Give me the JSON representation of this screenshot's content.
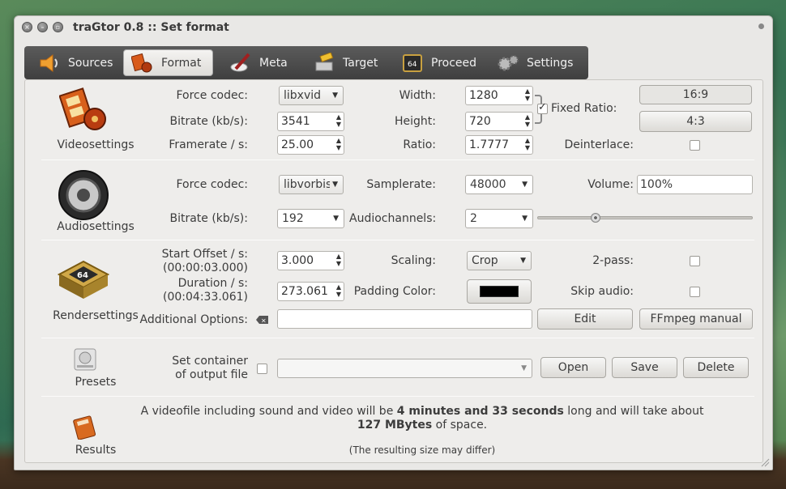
{
  "window": {
    "title": "traGtor 0.8 :: Set format"
  },
  "tabs": [
    {
      "label": "Sources",
      "icon": "speaker-icon"
    },
    {
      "label": "Format",
      "icon": "film-reel-icon",
      "active": true
    },
    {
      "label": "Meta",
      "icon": "pen-icon"
    },
    {
      "label": "Target",
      "icon": "hammer-icon"
    },
    {
      "label": "Proceed",
      "icon": "chip-64-icon"
    },
    {
      "label": "Settings",
      "icon": "gears-icon"
    }
  ],
  "video": {
    "section": "Videosettings",
    "force_codec_label": "Force codec:",
    "force_codec_value": "libxvid",
    "bitrate_label": "Bitrate (kb/s):",
    "bitrate_value": "3541",
    "framerate_label": "Framerate / s:",
    "framerate_value": "25.00",
    "width_label": "Width:",
    "width_value": "1280",
    "height_label": "Height:",
    "height_value": "720",
    "ratio_label": "Ratio:",
    "ratio_value": "1.7777",
    "fixed_ratio_label": "Fixed Ratio:",
    "fixed_ratio_checked": true,
    "btn_169": "16:9",
    "btn_43": "4:3",
    "deinterlace_label": "Deinterlace:"
  },
  "audio": {
    "section": "Audiosettings",
    "force_codec_label": "Force codec:",
    "force_codec_value": "libvorbis",
    "bitrate_label": "Bitrate (kb/s):",
    "bitrate_value": "192",
    "samplerate_label": "Samplerate:",
    "samplerate_value": "48000",
    "channels_label": "Audiochannels:",
    "channels_value": "2",
    "volume_label": "Volume:",
    "volume_value": "100%",
    "volume_level": 0.27
  },
  "render": {
    "section": "Rendersettings",
    "start_offset_label": "Start Offset / s:",
    "start_offset_sub": "(00:00:03.000)",
    "start_offset_value": "3.000",
    "duration_label": "Duration / s:",
    "duration_sub": "(00:04:33.061)",
    "duration_value": "273.061",
    "scaling_label": "Scaling:",
    "scaling_value": "Crop",
    "padding_label": "Padding Color:",
    "padding_color": "#000000",
    "twopass_label": "2-pass:",
    "skipaudio_label": "Skip audio:",
    "additional_label": "Additional Options:",
    "additional_value": "",
    "edit_label": "Edit",
    "ffmpeg_label": "FFmpeg manual"
  },
  "presets": {
    "section": "Presets",
    "container_label_1": "Set container",
    "container_label_2": "of output file",
    "container_value": "",
    "open_label": "Open",
    "save_label": "Save",
    "delete_label": "Delete"
  },
  "results": {
    "section": "Results",
    "text_pre": "A videofile including sound and video will be ",
    "duration_bold": "4 minutes and 33 seconds",
    "text_mid": " long and will take about ",
    "size_bold": "127 MBytes",
    "text_post": " of space.",
    "note": "(The resulting size may differ)"
  }
}
